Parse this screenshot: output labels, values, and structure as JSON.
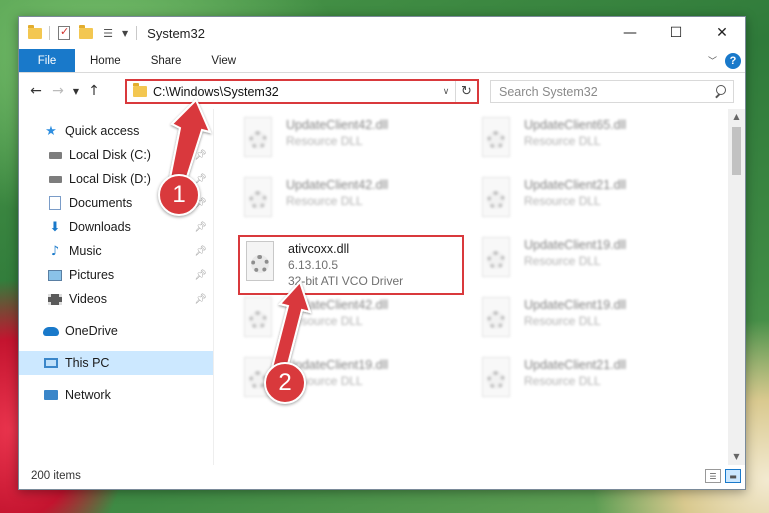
{
  "window": {
    "title": "System32",
    "controls": {
      "minimize": "—",
      "maximize": "☐",
      "close": "✕"
    }
  },
  "ribbon": {
    "tabs": [
      "File",
      "Home",
      "Share",
      "View"
    ],
    "help": "?"
  },
  "address": {
    "path": "C:\\Windows\\System32",
    "search_placeholder": "Search System32"
  },
  "sidebar": {
    "items": [
      {
        "label": "Quick access",
        "icon": "star-icon"
      },
      {
        "label": "Local Disk (C:)",
        "icon": "disk-icon",
        "pinned": true
      },
      {
        "label": "Local Disk (D:)",
        "icon": "disk-icon",
        "pinned": true
      },
      {
        "label": "Documents",
        "icon": "documents-icon",
        "pinned": true
      },
      {
        "label": "Downloads",
        "icon": "downloads-icon",
        "pinned": true
      },
      {
        "label": "Music",
        "icon": "music-icon",
        "pinned": true
      },
      {
        "label": "Pictures",
        "icon": "pictures-icon",
        "pinned": true
      },
      {
        "label": "Videos",
        "icon": "videos-icon",
        "pinned": true
      },
      {
        "label": "OneDrive",
        "icon": "onedrive-icon"
      },
      {
        "label": "This PC",
        "icon": "pc-icon",
        "selected": true
      },
      {
        "label": "Network",
        "icon": "network-icon"
      }
    ]
  },
  "files": [
    {
      "name": "UpdateClient42.dll",
      "type": "Resource DLL"
    },
    {
      "name": "UpdateClient65.dll",
      "type": "Resource DLL"
    },
    {
      "name": "UpdateClient42.dll",
      "type": "Resource DLL"
    },
    {
      "name": "UpdateClient21.dll",
      "type": "Resource DLL"
    },
    {
      "name": "ativcoxx.dll",
      "version": "6.13.10.5",
      "type": "32-bit ATI VCO Driver"
    },
    {
      "name": "UpdateClient19.dll",
      "type": "Resource DLL"
    },
    {
      "name": "UpdateClient42.dll",
      "type": "Resource DLL"
    },
    {
      "name": "UpdateClient19.dll",
      "type": "Resource DLL"
    },
    {
      "name": "UpdateClient19.dll",
      "type": "Resource DLL"
    },
    {
      "name": "UpdateClient21.dll",
      "type": "Resource DLL"
    }
  ],
  "status": {
    "item_count": "200 items"
  },
  "annotations": {
    "step1": "1",
    "step2": "2",
    "color": "#d9393c"
  }
}
